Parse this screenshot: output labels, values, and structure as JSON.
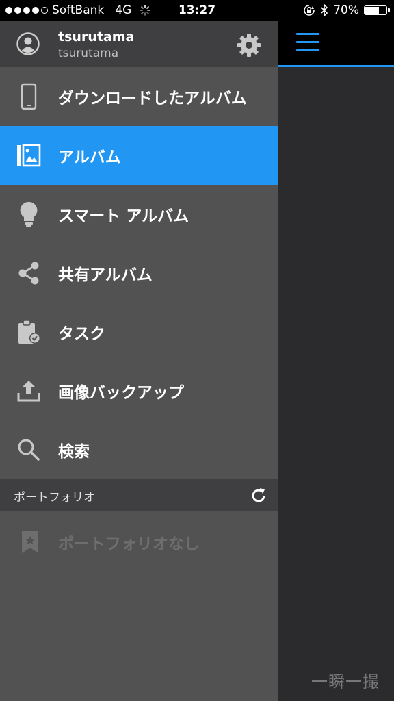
{
  "status_bar": {
    "carrier": "SoftBank",
    "network": "4G",
    "time": "13:27",
    "battery": "70%",
    "battery_level": 0.7
  },
  "profile": {
    "name": "tsurutama",
    "account": "tsurutama"
  },
  "menu": [
    {
      "label": "ダウンロードしたアルバム",
      "icon": "phone-icon",
      "active": false
    },
    {
      "label": "アルバム",
      "icon": "album-icon",
      "active": true
    },
    {
      "label": "スマート アルバム",
      "icon": "lightbulb-icon",
      "active": false
    },
    {
      "label": "共有アルバム",
      "icon": "share-icon",
      "active": false
    },
    {
      "label": "タスク",
      "icon": "clipboard-check-icon",
      "active": false
    },
    {
      "label": "画像バックアップ",
      "icon": "upload-icon",
      "active": false
    },
    {
      "label": "検索",
      "icon": "search-icon",
      "active": false
    }
  ],
  "portfolio": {
    "header": "ポートフォリオ",
    "empty_label": "ポートフォリオなし"
  },
  "watermark": "一瞬一撮",
  "colors": {
    "accent": "#2196f3",
    "drawer_bg": "#525252",
    "header_bg": "#3f3f41",
    "main_bg": "#2b2b2e"
  }
}
